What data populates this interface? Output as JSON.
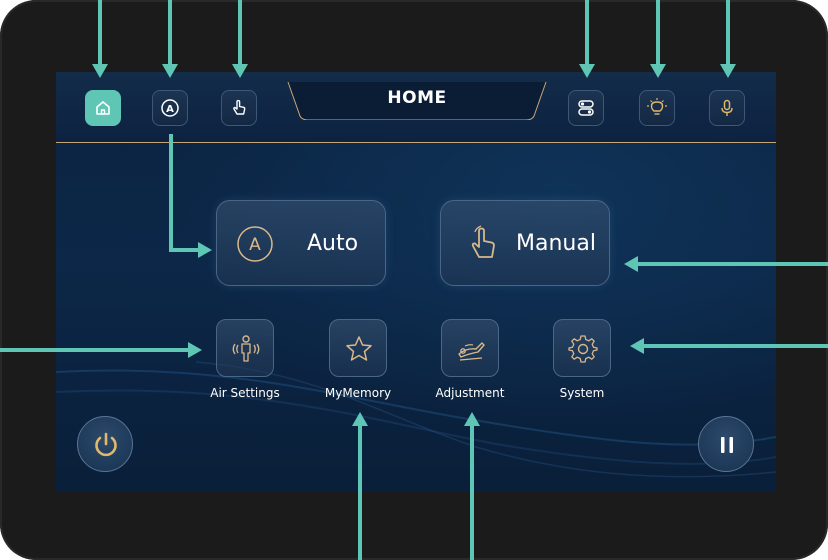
{
  "header": {
    "title": "HOME"
  },
  "top_left_buttons": [
    {
      "name": "home",
      "icon": "home-icon",
      "active": true
    },
    {
      "name": "auto",
      "icon": "auto-a-icon",
      "active": false
    },
    {
      "name": "manual",
      "icon": "hand-pointer-icon",
      "active": false
    }
  ],
  "top_right_buttons": [
    {
      "name": "toggle",
      "icon": "toggle-switch-icon"
    },
    {
      "name": "light",
      "icon": "light-bulb-icon"
    },
    {
      "name": "voice",
      "icon": "microphone-icon"
    }
  ],
  "main": {
    "auto": {
      "label": "Auto",
      "icon": "auto-a-icon"
    },
    "manual": {
      "label": "Manual",
      "icon": "hand-pointer-icon"
    }
  },
  "shortcuts": [
    {
      "label": "Air Settings",
      "icon": "air-person-icon"
    },
    {
      "label": "MyMemory",
      "icon": "star-icon"
    },
    {
      "label": "Adjustment",
      "icon": "recline-chair-icon"
    },
    {
      "label": "System",
      "icon": "gear-icon"
    }
  ],
  "footer": {
    "power_icon": "power-icon",
    "pause_icon": "pause-icon"
  },
  "colors": {
    "accent": "#5fc5b5",
    "gold": "#c9a676",
    "arrow": "#5fc5b5",
    "bezel": "#1c1b1b"
  }
}
